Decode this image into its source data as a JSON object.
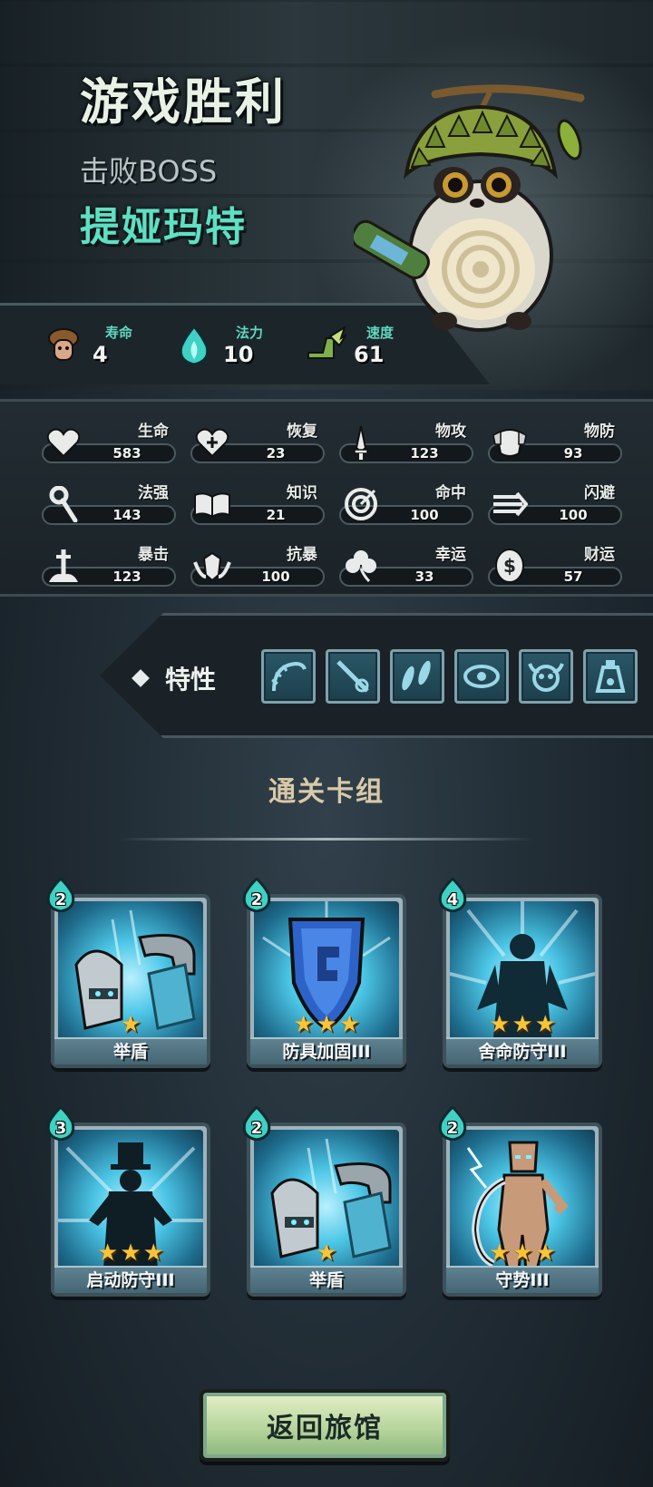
{
  "header": {
    "title": "游戏胜利",
    "subtitle": "击败BOSS",
    "boss_name": "提娅玛特"
  },
  "top_stats": [
    {
      "label": "寿命",
      "value": "4",
      "icon": "mushroom-character-icon"
    },
    {
      "label": "法力",
      "value": "10",
      "icon": "blue-flame-icon"
    },
    {
      "label": "速度",
      "value": "61",
      "icon": "winged-boot-icon"
    }
  ],
  "attributes": [
    {
      "label": "生命",
      "value": "583",
      "icon": "heart-icon"
    },
    {
      "label": "恢复",
      "value": "23",
      "icon": "heart-plus-icon"
    },
    {
      "label": "物攻",
      "value": "123",
      "icon": "sword-icon"
    },
    {
      "label": "物防",
      "value": "93",
      "icon": "armor-icon"
    },
    {
      "label": "法强",
      "value": "143",
      "icon": "staff-icon"
    },
    {
      "label": "知识",
      "value": "21",
      "icon": "book-icon"
    },
    {
      "label": "命中",
      "value": "100",
      "icon": "target-icon"
    },
    {
      "label": "闪避",
      "value": "100",
      "icon": "dash-arrows-icon"
    },
    {
      "label": "暴击",
      "value": "123",
      "icon": "crit-sword-icon"
    },
    {
      "label": "抗暴",
      "value": "100",
      "icon": "shield-wings-icon"
    },
    {
      "label": "幸运",
      "value": "33",
      "icon": "clover-icon"
    },
    {
      "label": "财运",
      "value": "57",
      "icon": "coin-icon"
    }
  ],
  "traits": {
    "label": "特性",
    "items": [
      "tentacle-trait-icon",
      "rod-trait-icon",
      "feathers-trait-icon",
      "eye-trait-icon",
      "horned-skull-trait-icon",
      "potion-trait-icon"
    ]
  },
  "deck": {
    "title": "通关卡组",
    "cards": [
      {
        "name": "举盾",
        "cost": "2",
        "stars": 1,
        "art": "knight-shield"
      },
      {
        "name": "防具加固III",
        "cost": "2",
        "stars": 3,
        "art": "blue-shield"
      },
      {
        "name": "舍命防守III",
        "cost": "4",
        "stars": 3,
        "art": "silhouette-hero"
      },
      {
        "name": "启动防守III",
        "cost": "3",
        "stars": 3,
        "art": "silhouette-tophat"
      },
      {
        "name": "举盾",
        "cost": "2",
        "stars": 1,
        "art": "knight-shield"
      },
      {
        "name": "守势III",
        "cost": "2",
        "stars": 3,
        "art": "wooden-dummy"
      }
    ]
  },
  "footer": {
    "return_button": "返回旅馆"
  },
  "colors": {
    "accent_teal": "#5ee0c2",
    "star_gold": "#f7c43a",
    "button_green": "#b7d59c"
  }
}
